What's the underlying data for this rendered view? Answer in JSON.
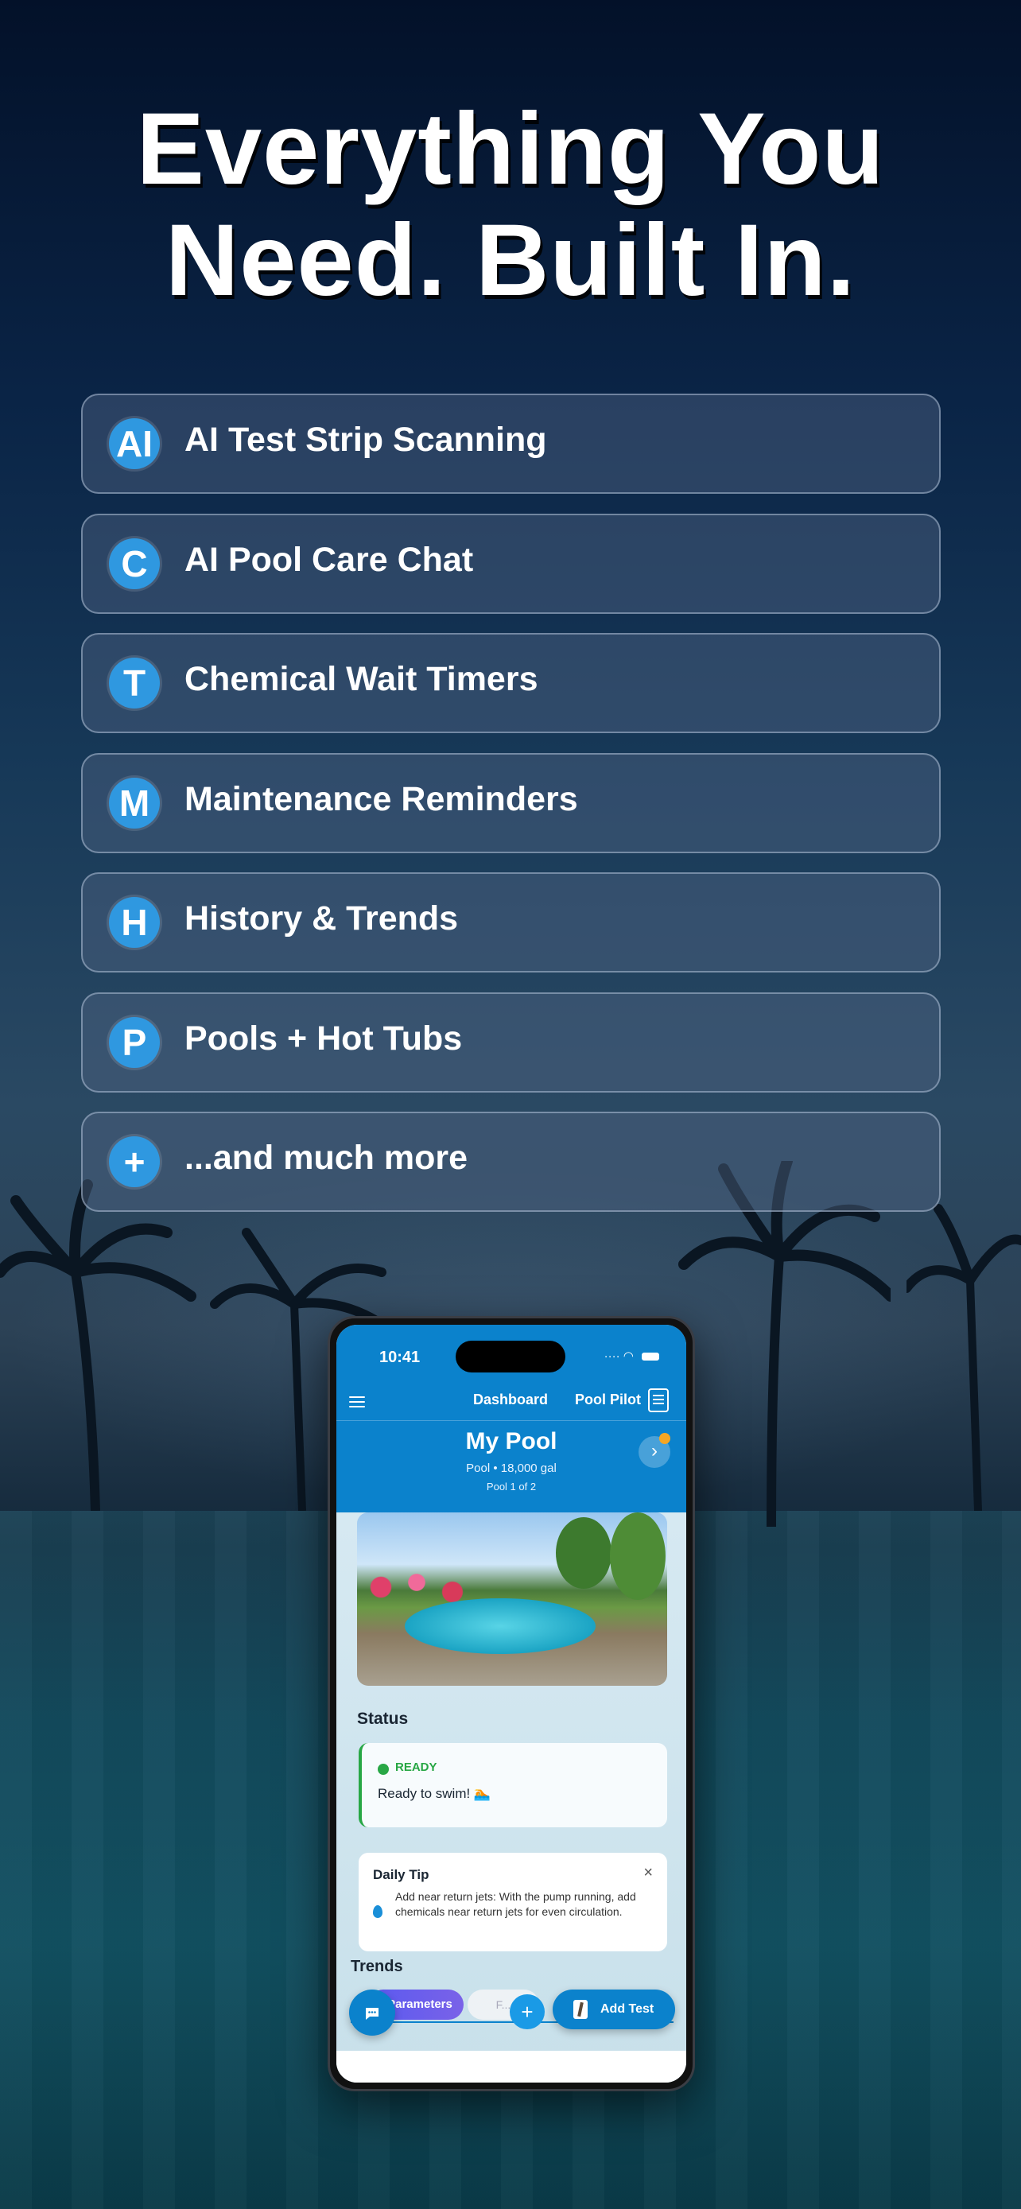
{
  "headline": {
    "line1": "Everything You",
    "line2": "Need. Built In."
  },
  "features": [
    {
      "badge": "AI",
      "label": "AI Test Strip Scanning"
    },
    {
      "badge": "C",
      "label": "AI Pool Care Chat"
    },
    {
      "badge": "T",
      "label": "Chemical Wait Timers"
    },
    {
      "badge": "M",
      "label": "Maintenance Reminders"
    },
    {
      "badge": "H",
      "label": "History & Trends"
    },
    {
      "badge": "P",
      "label": "Pools + Hot Tubs"
    },
    {
      "badge": "+",
      "label": "...and much more"
    }
  ],
  "phone": {
    "time": "10:41",
    "nav": {
      "dashboard": "Dashboard",
      "app_name": "Pool Pilot"
    },
    "pool": {
      "name": "My Pool",
      "meta": "Pool • 18,000 gal",
      "index": "Pool 1 of 2"
    },
    "status": {
      "section": "Status",
      "label": "READY",
      "text": "Ready to swim! 🏊"
    },
    "tip": {
      "title": "Daily Tip",
      "close": "×",
      "body": "Add near return jets: With the pump running, add chemicals near return jets for even circulation."
    },
    "trends": {
      "section": "Trends",
      "tab_parameters": "Parameters",
      "tab_second": "F..."
    },
    "actions": {
      "plus": "+",
      "add_test": "Add Test"
    }
  },
  "colors": {
    "accent": "#2f98e0",
    "app_blue": "#0b82cc",
    "ready_green": "#28a745"
  }
}
